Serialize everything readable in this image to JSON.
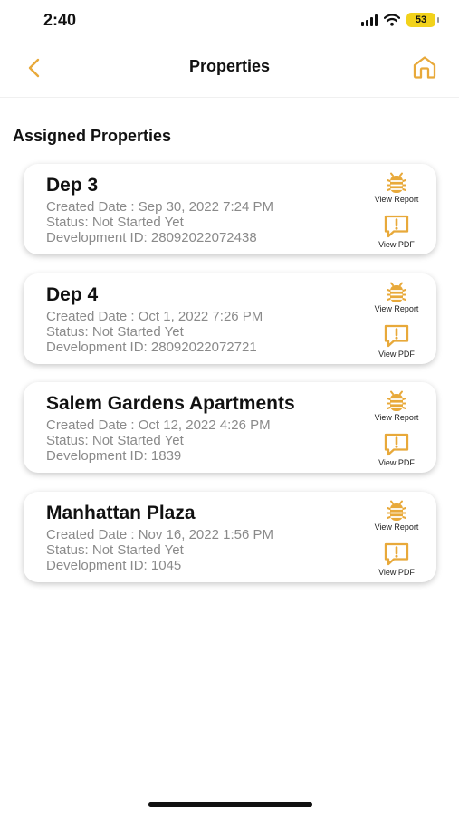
{
  "status_bar": {
    "time": "2:40",
    "battery": "53",
    "battery_color": "#f2d21b"
  },
  "nav": {
    "title": "Properties",
    "back_icon": "chevron-left-icon",
    "home_icon": "home-icon",
    "accent_color": "#e8a93a"
  },
  "section": {
    "title": "Assigned Properties"
  },
  "properties": [
    {
      "name": "Dep 3",
      "created": "Created Date : Sep 30, 2022 7:24 PM",
      "status": "Status: Not Started Yet",
      "development_id": "Development ID: 28092022072438",
      "report_label": "View Report",
      "pdf_label": "View PDF"
    },
    {
      "name": "Dep 4",
      "created": "Created Date : Oct 1, 2022 7:26 PM",
      "status": "Status: Not Started Yet",
      "development_id": "Development ID: 28092022072721",
      "report_label": "View Report",
      "pdf_label": "View PDF"
    },
    {
      "name": "Salem Gardens Apartments",
      "created": "Created Date : Oct 12, 2022 4:26 PM",
      "status": "Status: Not Started Yet",
      "development_id": "Development ID: 1839",
      "report_label": "View Report",
      "pdf_label": "View PDF"
    },
    {
      "name": "Manhattan Plaza",
      "created": "Created Date : Nov 16, 2022 1:56 PM",
      "status": "Status: Not Started Yet",
      "development_id": "Development ID: 1045",
      "report_label": "View Report",
      "pdf_label": "View PDF"
    }
  ]
}
